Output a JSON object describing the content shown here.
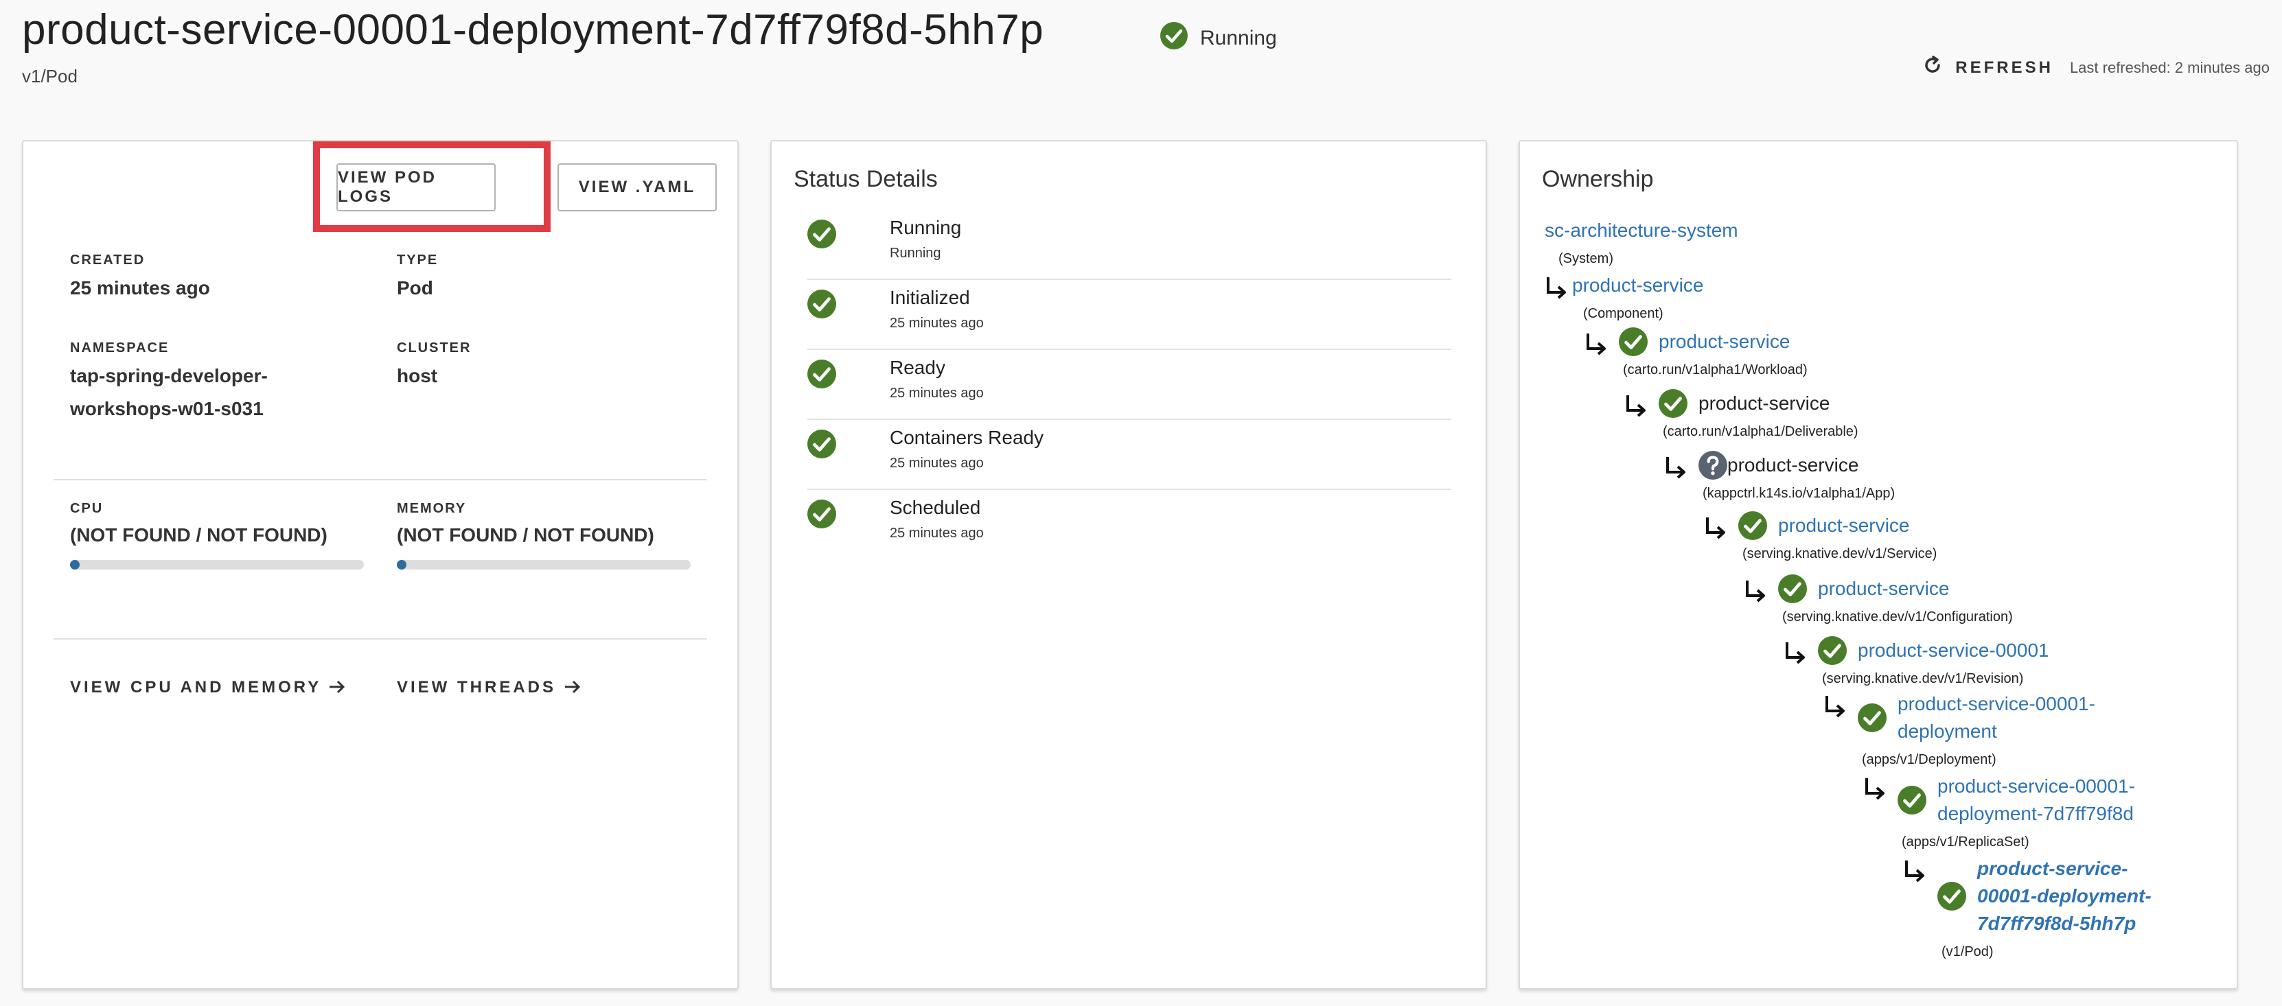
{
  "header": {
    "title": "product-service-00001-deployment-7d7ff79f8d-5hh7p",
    "kind": "v1/Pod",
    "status": "Running",
    "refresh_label": "REFRESH",
    "last_refreshed": "Last refreshed: 2 minutes ago"
  },
  "overview": {
    "view_logs_label": "VIEW POD LOGS",
    "view_yaml_label": "VIEW .YAML",
    "created_label": "CREATED",
    "created_value": "25 minutes ago",
    "type_label": "TYPE",
    "type_value": "Pod",
    "namespace_label": "NAMESPACE",
    "namespace_value_line1": "tap-spring-developer-",
    "namespace_value_line2": "workshops-w01-s031",
    "cluster_label": "CLUSTER",
    "cluster_value": "host",
    "cpu_label": "CPU",
    "cpu_value": "(NOT FOUND / NOT FOUND)",
    "cpu_fraction": 0,
    "memory_label": "MEMORY",
    "memory_value": "(NOT FOUND / NOT FOUND)",
    "memory_fraction": 0,
    "view_cpu_memory_label": "VIEW CPU AND MEMORY",
    "view_threads_label": "VIEW THREADS"
  },
  "status_details": {
    "title": "Status Details",
    "conditions": [
      {
        "name": "Running",
        "time": "Running"
      },
      {
        "name": "Initialized",
        "time": "25 minutes ago"
      },
      {
        "name": "Ready",
        "time": "25 minutes ago"
      },
      {
        "name": "Containers Ready",
        "time": "25 minutes ago"
      },
      {
        "name": "Scheduled",
        "time": "25 minutes ago"
      }
    ]
  },
  "ownership": {
    "title": "Ownership",
    "nodes": [
      {
        "name": "sc-architecture-system",
        "kind": "(System)",
        "icon": "none"
      },
      {
        "name": "product-service",
        "kind": "(Component)",
        "icon": "none"
      },
      {
        "name": "product-service",
        "kind": "(carto.run/v1alpha1/Workload)",
        "icon": "check-icon"
      },
      {
        "name": "product-service",
        "kind": "(carto.run/v1alpha1/Deliverable)",
        "icon": "check-icon"
      },
      {
        "name": "product-service",
        "kind": "(kappctrl.k14s.io/v1alpha1/App)",
        "icon": "question-icon"
      },
      {
        "name": "product-service",
        "kind": "(serving.knative.dev/v1/Service)",
        "icon": "check-icon"
      },
      {
        "name": "product-service",
        "kind": "(serving.knative.dev/v1/Configuration)",
        "icon": "check-icon"
      },
      {
        "name": "product-service-00001",
        "kind": "(serving.knative.dev/v1/Revision)",
        "icon": "check-icon"
      },
      {
        "name_line1": "product-service-00001-",
        "name_line2": "deployment",
        "kind": "(apps/v1/Deployment)",
        "icon": "check-icon"
      },
      {
        "name_line1": "product-service-00001-",
        "name_line2": "deployment-7d7ff79f8d",
        "kind": "(apps/v1/ReplicaSet)",
        "icon": "check-icon"
      },
      {
        "name_line1": "product-service-",
        "name_line2": "00001-deployment-",
        "name_line3": "7d7ff79f8d-5hh7p",
        "kind": "(v1/Pod)",
        "icon": "check-icon"
      }
    ]
  },
  "colors": {
    "accent": "#e03c44",
    "link": "#2f73b4",
    "success": "#4a7d29",
    "progress": "#2e6b9e"
  }
}
